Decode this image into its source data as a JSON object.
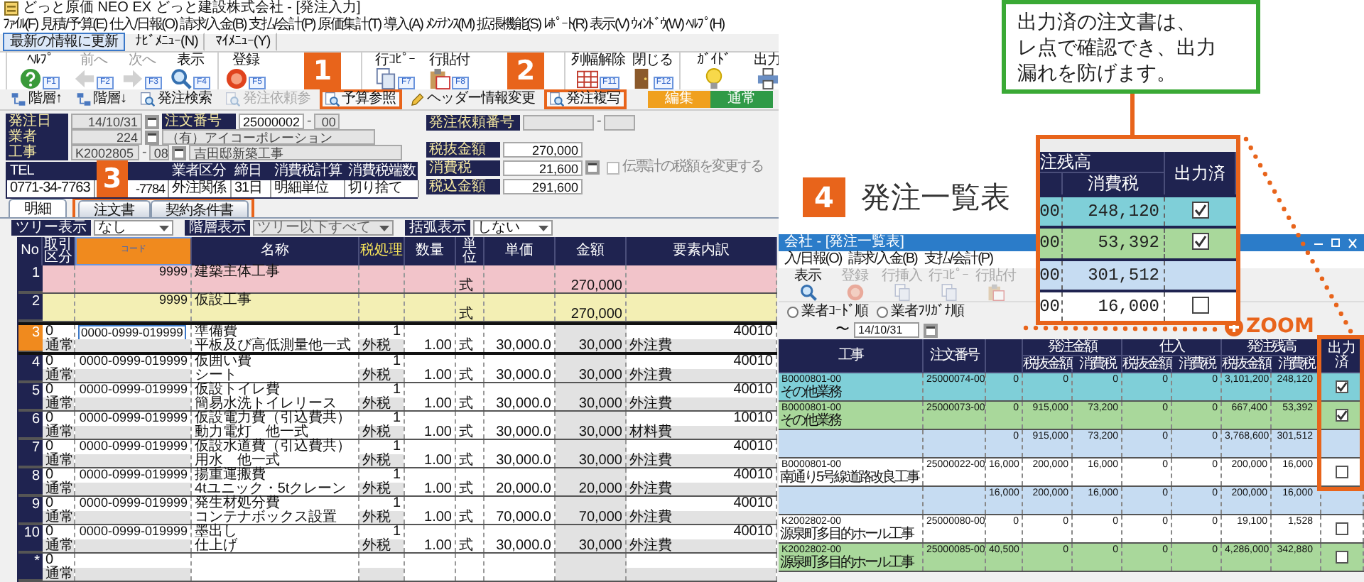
{
  "main": {
    "title": "どっと原価 NEO EX どっと建設株式会社 - [発注入力]",
    "menu": [
      "ﾌｧｲﾙ(F)",
      "見積/予算(E)",
      "仕入/日報(O)",
      "請求/入金(B)",
      "支払/会計(P)",
      "原価集計(T)",
      "導入(A)",
      "ﾒﾝﾃﾅﾝｽ(M)",
      "拡張機能(S)",
      "ﾚﾎﾟｰﾄ(R)",
      "表示(V)",
      "ｳｨﾝﾄﾞｳ(W)",
      "ﾍﾙﾌﾟ(H)"
    ],
    "nav": [
      {
        "label": "最新の情報に更新",
        "selected": true
      },
      {
        "label": "ﾅﾋﾞﾒﾆｭｰ(N)",
        "selected": false
      },
      {
        "label": "ﾏｲﾒﾆｭｰ(Y)",
        "selected": false
      }
    ],
    "toolbar": [
      {
        "kind": "group",
        "items": [
          {
            "label": "ﾍﾙﾌﾟ",
            "key": "F1",
            "disabled": false
          },
          {
            "label": "前へ",
            "key": "F2",
            "disabled": true
          },
          {
            "label": "次へ",
            "key": "F3",
            "disabled": true
          },
          {
            "label": "表示",
            "key": "F4",
            "disabled": false
          }
        ]
      },
      {
        "kind": "group",
        "items": [
          {
            "label": "登録",
            "key": "F5",
            "disabled": false
          }
        ]
      },
      {
        "kind": "badge",
        "text": "1"
      },
      {
        "kind": "group",
        "items": [
          {
            "label": "行ｺﾋﾟｰ",
            "key": "F7",
            "disabled": false
          },
          {
            "label": "行貼付",
            "key": "F8",
            "disabled": false
          }
        ]
      },
      {
        "kind": "badge",
        "text": "2"
      },
      {
        "kind": "group",
        "items": [
          {
            "label": "列幅解除",
            "key": "F11",
            "disabled": false
          },
          {
            "label": "閉じる",
            "key": "F12",
            "disabled": false
          }
        ]
      },
      {
        "kind": "group",
        "items": [
          {
            "label": "ｶﾞｲﾄﾞ",
            "disabled": false
          },
          {
            "label": "出力",
            "disabled": false
          }
        ]
      }
    ],
    "actions": [
      {
        "label": "階層↑",
        "disabled": false,
        "highlighted": false
      },
      {
        "label": "階層↓",
        "disabled": false,
        "highlighted": false
      },
      {
        "label": "発注検索",
        "disabled": false,
        "highlighted": false
      },
      {
        "label": "発注依頼参",
        "disabled": true,
        "highlighted": false
      },
      {
        "label": "予算参照",
        "disabled": false,
        "highlighted": true
      },
      {
        "label": "ヘッダー情報変更",
        "disabled": false,
        "highlighted": false
      },
      {
        "label": "発注複写",
        "disabled": false,
        "highlighted": true
      }
    ],
    "modes": [
      {
        "label": "編集",
        "color": "#f0a01e"
      },
      {
        "label": "通常",
        "color": "#2f9a47"
      }
    ],
    "header": {
      "order_date": {
        "label": "発注日",
        "value": "14/10/31"
      },
      "order_no": {
        "label": "注文番号",
        "value": "25000002",
        "separator": "-",
        "branch": "00"
      },
      "vendor": {
        "label": "業者",
        "code": "224",
        "name": "（有）アイコーポレーション"
      },
      "project": {
        "label": "工事",
        "code": "K2002805",
        "separator": "-",
        "branch": "08",
        "name": "吉田邸新築工事"
      },
      "info": [
        {
          "heading": "TEL",
          "value": "0771-34-7763"
        },
        {
          "value": "-7784"
        },
        {
          "heading": "業者区分",
          "value": "外注関係"
        },
        {
          "heading": "締日",
          "value": "31日"
        },
        {
          "heading": "消費税計算",
          "value": "明細単位"
        },
        {
          "heading": "消費税端数",
          "value": "切り捨て"
        }
      ],
      "badge": "3",
      "request": {
        "label": "発注依頼番号",
        "separator": "-"
      },
      "totals": [
        {
          "label": "税抜金額",
          "value": "270,000",
          "button": false
        },
        {
          "label": "消費税",
          "value": "21,600",
          "button": true
        },
        {
          "label": "税込金額",
          "value": "291,600",
          "button": false
        }
      ],
      "tax_override": {
        "label": "伝票計の税額を変更する",
        "checked": false,
        "disabled": true
      }
    },
    "tabs": [
      {
        "label": "明細",
        "selected": true,
        "highlighted": false
      },
      {
        "label": "注文書",
        "selected": false,
        "highlighted": true
      },
      {
        "label": "契約条件書",
        "selected": false,
        "highlighted": true
      }
    ],
    "filters": [
      {
        "label": "ツリー表示",
        "value": "なし",
        "disabled": false
      },
      {
        "label": "階層表示",
        "value": "ツリー以下すべて",
        "disabled": true
      },
      {
        "label": "括弧表示",
        "value": "しない",
        "disabled": false
      }
    ],
    "grid": {
      "columns": [
        {
          "label": "No",
          "kind": "plain"
        },
        {
          "label": "取引区分",
          "kind": "plain"
        },
        {
          "label": "コード",
          "kind": "key"
        },
        {
          "label": "名称",
          "kind": "plain"
        },
        {
          "label": "税処理",
          "kind": "flag"
        },
        {
          "label": "数量",
          "kind": "plain"
        },
        {
          "label": "単位",
          "kind": "plain"
        },
        {
          "label": "単価",
          "kind": "plain"
        },
        {
          "label": "金額",
          "kind": "plain"
        },
        {
          "label": "要素内訳",
          "kind": "plain"
        }
      ],
      "rows": [
        {
          "no": "1",
          "kind": "group",
          "color": "#f2c4ca",
          "selected": false,
          "code": "9999",
          "name": "建築主体工事",
          "unit": "式",
          "amount": "270,000"
        },
        {
          "no": "2",
          "kind": "group",
          "color": "#f3efb4",
          "selected": false,
          "code": "9999",
          "name": "仮設工事",
          "unit": "式",
          "amount": "270,000"
        },
        {
          "no": "3",
          "kind": "item",
          "selected": true,
          "type": "0",
          "type_name": "通常",
          "code": "0000-0999-019999",
          "name": "準備費",
          "detail": "平板及び高低測量他一式",
          "count": "1",
          "tax": "外税",
          "qty": "1.00",
          "unit": "式",
          "price": "30,000.0",
          "amount": "30,000",
          "element": "40010",
          "element_name": "外注費"
        },
        {
          "no": "4",
          "kind": "item",
          "selected": false,
          "type": "0",
          "type_name": "通常",
          "code": "0000-0999-019999",
          "name": "仮囲い費",
          "detail": "シート",
          "count": "1",
          "tax": "外税",
          "qty": "1.00",
          "unit": "式",
          "price": "30,000.0",
          "amount": "30,000",
          "element": "40010",
          "element_name": "外注費"
        },
        {
          "no": "5",
          "kind": "item",
          "selected": false,
          "type": "0",
          "type_name": "通常",
          "code": "0000-0999-019999",
          "name": "仮設トイレ費",
          "detail": "簡易水洗トイレリース",
          "count": "1",
          "tax": "外税",
          "qty": "1.00",
          "unit": "式",
          "price": "30,000.0",
          "amount": "30,000",
          "element": "40010",
          "element_name": "外注費"
        },
        {
          "no": "6",
          "kind": "item",
          "selected": false,
          "type": "0",
          "type_name": "通常",
          "code": "0000-0999-019999",
          "name": "仮設電力費（引込費共）",
          "detail": "動力電灯　他一式",
          "count": "1",
          "tax": "外税",
          "qty": "1.00",
          "unit": "式",
          "price": "30,000.0",
          "amount": "30,000",
          "element": "10010",
          "element_name": "材料費"
        },
        {
          "no": "7",
          "kind": "item",
          "selected": false,
          "type": "0",
          "type_name": "通常",
          "code": "0000-0999-019999",
          "name": "仮設水道費（引込費共）",
          "detail": "用水　他一式",
          "count": "1",
          "tax": "外税",
          "qty": "1.00",
          "unit": "式",
          "price": "30,000.0",
          "amount": "30,000",
          "element": "40010",
          "element_name": "外注費"
        },
        {
          "no": "8",
          "kind": "item",
          "selected": false,
          "type": "0",
          "type_name": "通常",
          "code": "0000-0999-019999",
          "name": "揚重運搬費",
          "detail": "4tユニック・5tクレーン",
          "count": "1",
          "tax": "外税",
          "qty": "1.00",
          "unit": "式",
          "price": "20,000.0",
          "amount": "20,000",
          "element": "40010",
          "element_name": "外注費"
        },
        {
          "no": "9",
          "kind": "item",
          "selected": false,
          "type": "0",
          "type_name": "通常",
          "code": "0000-0999-019999",
          "name": "発生材処分費",
          "detail": "コンテナボックス設置",
          "count": "1",
          "tax": "外税",
          "qty": "1.00",
          "unit": "式",
          "price": "70,000.0",
          "amount": "70,000",
          "element": "40010",
          "element_name": "外注費"
        },
        {
          "no": "10",
          "kind": "item",
          "selected": false,
          "type": "0",
          "type_name": "通常",
          "code": "0000-0999-019999",
          "name": "墨出し",
          "detail": "仕上げ",
          "count": "1",
          "tax": "外税",
          "qty": "1.00",
          "unit": "式",
          "price": "30,000.0",
          "amount": "30,000",
          "element": "40010",
          "element_name": "外注費"
        },
        {
          "no": "*",
          "kind": "new",
          "selected": false,
          "type": "0",
          "type_name": "通常"
        }
      ]
    }
  },
  "list": {
    "title": "会社 - [発注一覧表]",
    "menu": [
      "入/日報(O)",
      "請求/入金(B)",
      "支払/会計(P)"
    ],
    "toolbar": [
      {
        "label": "表示",
        "disabled": false
      },
      {
        "label": "登録",
        "disabled": true
      },
      {
        "label": "行挿入",
        "disabled": true
      },
      {
        "label": "行ｺﾋﾟｰ",
        "disabled": true
      },
      {
        "label": "行貼付",
        "disabled": true
      }
    ],
    "sort": [
      {
        "label": "業者ｺｰﾄﾞ順",
        "selected": false
      },
      {
        "label": "業者ﾌﾘｶﾞﾅ順",
        "selected": false
      }
    ],
    "date": {
      "separator": "〜",
      "value": "14/10/31"
    },
    "table": {
      "columns": [
        {
          "kind": "single",
          "label": "工事"
        },
        {
          "kind": "single",
          "label": "注文番号"
        },
        {
          "kind": "blank"
        },
        {
          "kind": "group",
          "label": "発注金額",
          "subs": [
            "税抜金額",
            "消費税"
          ]
        },
        {
          "kind": "group",
          "label": "仕入",
          "subs": [
            "税抜金額",
            "消費税"
          ]
        },
        {
          "kind": "group",
          "label": "発注残高",
          "subs": [
            "税抜金額",
            "消費税"
          ]
        },
        {
          "kind": "single",
          "label": "出力済"
        }
      ],
      "rows": [
        {
          "kind": "item",
          "color": "#7fcfd8",
          "code": "B0000801-00",
          "name": "その他業務",
          "order_no": "25000074-00",
          "column_3": "0",
          "values": [
            "0",
            "0",
            "0",
            "0",
            "3,101,200",
            "248,120"
          ],
          "output_checked": true
        },
        {
          "kind": "item",
          "color": "#a9d89b",
          "code": "B0000801-00",
          "name": "その他業務",
          "order_no": "25000073-00",
          "column_3": "0",
          "values": [
            "915,000",
            "73,200",
            "0",
            "0",
            "667,400",
            "53,392"
          ],
          "output_checked": true
        },
        {
          "kind": "total",
          "color": "#c6dcf2",
          "column_3": "0",
          "values": [
            "915,000",
            "73,200",
            "0",
            "0",
            "3,768,600",
            "301,512"
          ]
        },
        {
          "kind": "item",
          "color": "#ffffff",
          "code": "B0000801-00",
          "name": "南通り5号線道路改良工事",
          "order_no": "25000022-00",
          "column_3": "16,000",
          "values": [
            "200,000",
            "16,000",
            "0",
            "0",
            "200,000",
            "16,000"
          ],
          "output_checked": false
        },
        {
          "kind": "total",
          "color": "#c6dcf2",
          "column_3": "16,000",
          "values": [
            "200,000",
            "16,000",
            "0",
            "0",
            "200,000",
            "16,000"
          ]
        },
        {
          "kind": "item",
          "color": "#ffffff",
          "code": "K2002802-00",
          "name": "源泉町多目的ホール工事",
          "order_no": "25000080-00",
          "column_3": "0",
          "values": [
            "0",
            "0",
            "0",
            "0",
            "19,100",
            "1,528"
          ],
          "output_checked": false
        },
        {
          "kind": "item",
          "color": "#a9d89b",
          "code": "K2002802-00",
          "name": "源泉町多目的ホール工事",
          "order_no": "25000085-00",
          "column_3": "40,500",
          "values": [
            "0",
            "0",
            "0",
            "0",
            "4,286,000",
            "342,880"
          ],
          "output_checked": false
        }
      ]
    }
  },
  "annotations": {
    "callout": [
      "出力済の注文書は、",
      "レ点で確認でき、出力",
      "漏れを防げます。"
    ],
    "badge": "4",
    "label": "発注一覧表",
    "zoom_label": "ZOOM",
    "inset": {
      "group_heading": "注残高",
      "column": "消費税",
      "output_heading": "出力済",
      "rows": [
        {
          "kind": "item",
          "color": "#7fcfd8",
          "column_1": "00",
          "tax": "248,120",
          "output_checked": true
        },
        {
          "kind": "item",
          "color": "#a9d89b",
          "column_1": "00",
          "tax": "53,392",
          "output_checked": true
        },
        {
          "kind": "total",
          "color": "#c6dcf2",
          "column_1": "00",
          "tax": "301,512"
        },
        {
          "kind": "item",
          "color": "#ffffff",
          "column_1": "00",
          "tax": "16,000",
          "output_checked": false
        }
      ]
    }
  }
}
